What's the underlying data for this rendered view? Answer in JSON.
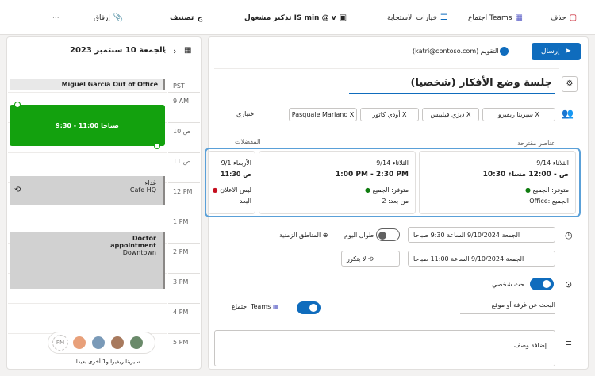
{
  "toolbar": {
    "more_label": "···",
    "attach_label": "إرفاق",
    "category_label": "تصنيف",
    "grammar_label": "تذكير مشغول IS min @ v",
    "response_label": "خيارات الاستجابة",
    "teams_label": "اجتماع Teams",
    "delete_label": "حذف"
  },
  "calendar": {
    "title": "الجمعة 10 سبتمبر 2023",
    "tz": "PST",
    "all_day_event": "Miguel Garcia Out of Office",
    "hours": [
      "9 AM",
      "10 ص",
      "11 ص",
      "12 PM",
      "1 PM",
      "2 PM",
      "3 PM",
      "4 PM",
      "5 PM"
    ],
    "event_main": "9:30 - 11:00 صباحا",
    "event_lunch_title": "غداء",
    "event_lunch_loc": "Cafe HQ",
    "event_doctor_title": "Doctor appointment",
    "event_doctor_loc": "Downtown",
    "attendees_footer": "سيرينا ريفيرا و1 أخرى بعيدا",
    "avatar_initials": "PM"
  },
  "form": {
    "send_label": "إرسال",
    "calendar_label": "التقويم",
    "account": "(katri@contoso.com)",
    "title": "جلسة وضع الأفكار (شخصيا)",
    "attendees": [
      "سيرينا ريفيرو X",
      "ديزي فيليبس X",
      "أودي كاتور X",
      "Pasquale Mariano X"
    ],
    "optional_label": "اختياري",
    "favorites_label": "المفضلات",
    "suggested_label": "عناصر مقترحة",
    "suggestions": [
      {
        "day": "الثلاثاء 9/14",
        "time": "10:30 ص - 12:00 مساء",
        "status": "متوفر: الجميع",
        "loc": "Office: الجميع"
      },
      {
        "day": "الثلاثاء 9/14",
        "time": "1:00 PM - 2:30 PM",
        "status": "متوفر: الجميع",
        "loc": "من بعد: 2"
      },
      {
        "day": "الأربعاء 9/1",
        "time": "11:30 ص",
        "status": "ليس الاعلان",
        "loc": "البعد"
      }
    ],
    "start_date": "الجمعة 9/10/2024 الساعة 9:30 صباحا",
    "end_date": "الجمعة 9/10/2024 الساعة 11:00 صباحا",
    "allday_label": "طوال اليوم",
    "timezone_label": "المناطق الزمنية",
    "repeat_label": "لا يتكرر",
    "inperson_label": "حث شخصي",
    "room_label": "البحث عن غرفة أو موقع",
    "teams_meeting_label": "اجتماع Teams",
    "description_placeholder": "إضافة وصف"
  },
  "colors": {
    "accent": "#0f6cbd",
    "event_green": "#13a10e",
    "event_gray": "#d1d1d1"
  }
}
